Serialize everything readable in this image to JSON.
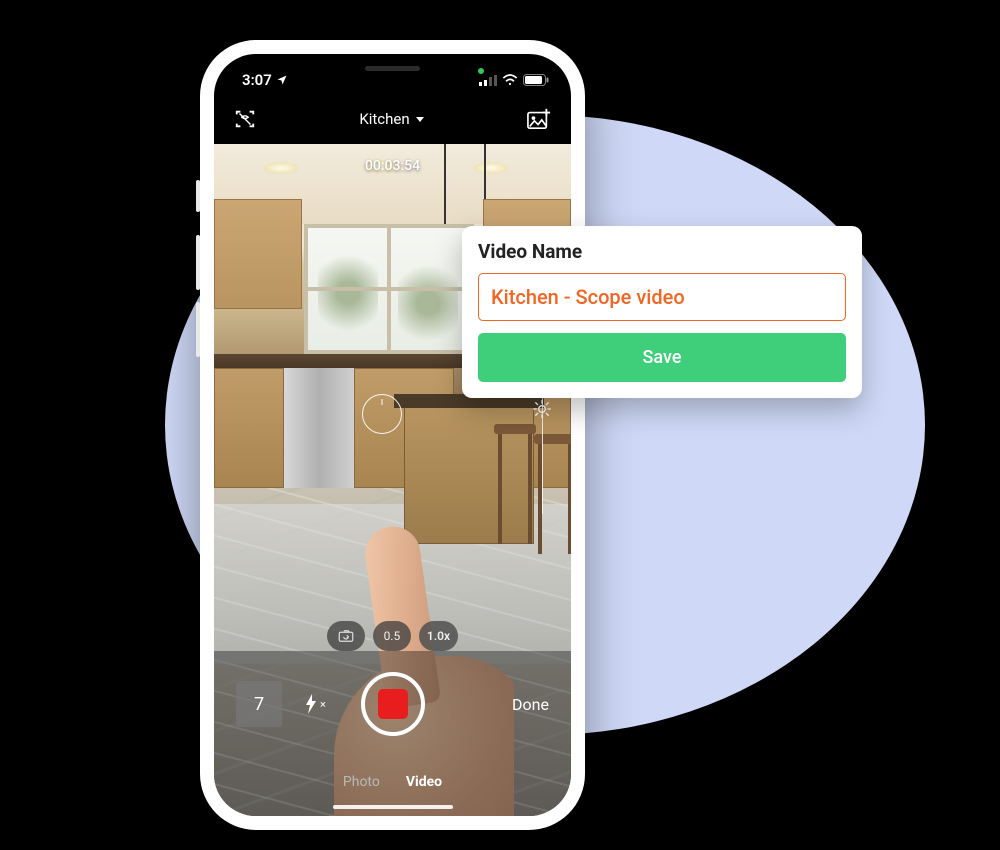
{
  "status": {
    "time": "3:07",
    "location_arrow": "↗"
  },
  "top_bar": {
    "title": "Kitchen"
  },
  "timer": "00:03:54",
  "zoom": {
    "wide": "0.5",
    "normal": "1.0x"
  },
  "controls": {
    "count": "7",
    "flash_suffix": "×",
    "done": "Done"
  },
  "modes": {
    "photo": "Photo",
    "video": "Video"
  },
  "popup": {
    "title": "Video Name",
    "value": "Kitchen - Scope video",
    "save": "Save"
  }
}
